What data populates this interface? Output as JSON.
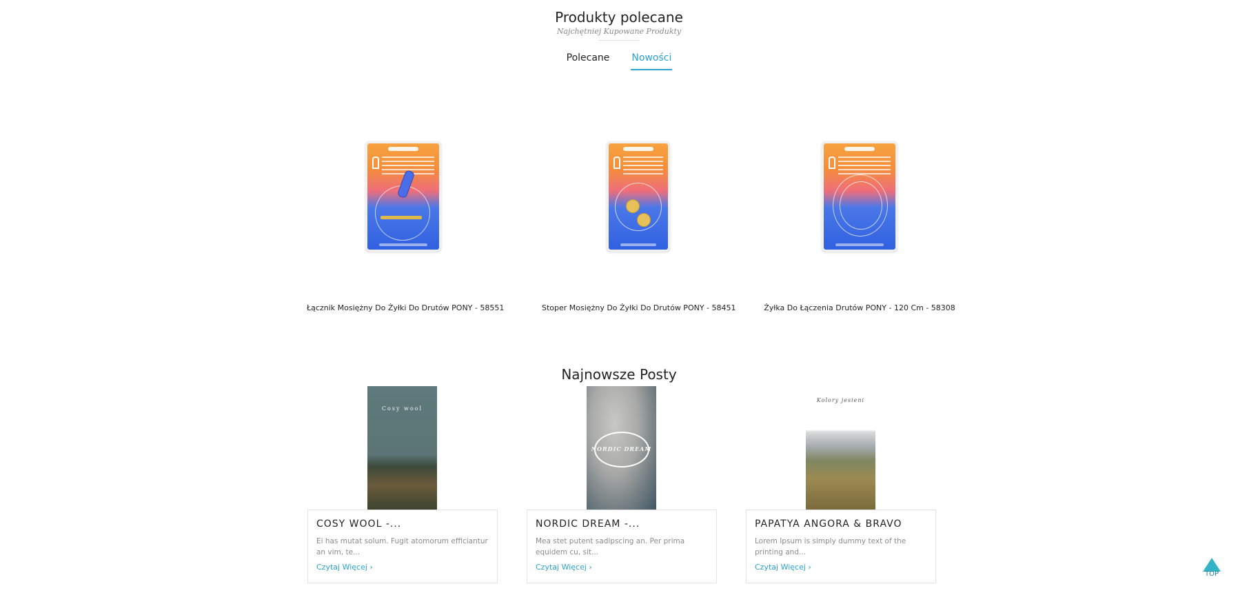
{
  "featured": {
    "title": "Produkty polecane",
    "subtitle": "Najchętniej Kupowane Produkty",
    "tabs": [
      {
        "label": "Polecane",
        "active": false
      },
      {
        "label": "Nowości",
        "active": true
      }
    ],
    "products": [
      {
        "name": "Łącznik Mosiężny Do Żyłki Do Drutów PONY - 58551"
      },
      {
        "name": "Stoper Mosiężny Do Żyłki Do Drutów PONY - 58451"
      },
      {
        "name": "Żyłka Do Łączenia Drutów PONY - 120 Cm - 58308"
      }
    ]
  },
  "posts": {
    "title": "Najnowsze Posty",
    "items": [
      {
        "title": "COSY WOOL -...",
        "excerpt": "Ei has mutat solum. Fugit atomorum efficiantur an vim, te...",
        "more": "Czytaj Więcej ›",
        "image_text": [
          "Cosy wool"
        ]
      },
      {
        "title": "NORDIC DREAM -...",
        "excerpt": "Mea stet putent sadipscing an. Per prima equidem cu, sit...",
        "more": "Czytaj Więcej ›",
        "image_text": [
          "NORDIC DREAM"
        ]
      },
      {
        "title": "PAPATYA ANGORA & BRAVO",
        "excerpt": "Lorem Ipsum is simply dummy text of the printing and...",
        "more": "Czytaj Więcej ›",
        "image_text": [
          "Kolory jesieni"
        ]
      }
    ]
  },
  "back_to_top": {
    "label": "TOP"
  },
  "colors": {
    "accent": "#2aa3d0",
    "top_button": "#32b3c6"
  }
}
